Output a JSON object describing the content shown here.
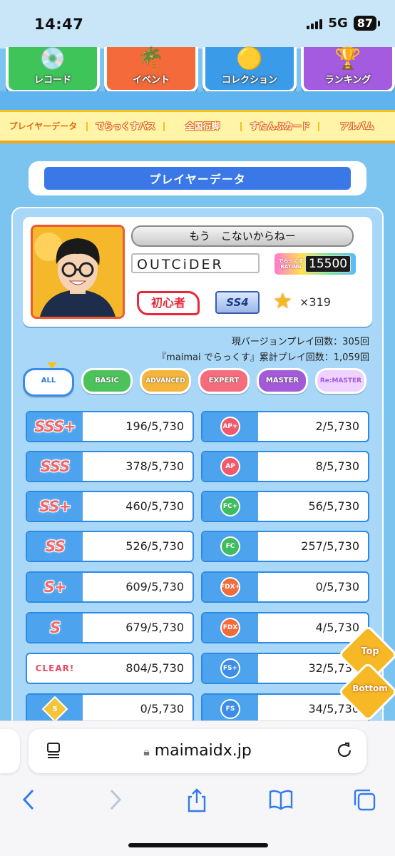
{
  "status": {
    "time": "14:47",
    "network": "5G",
    "battery": "87"
  },
  "top_tiles": [
    {
      "label": "レコード",
      "color": "#3fc45a"
    },
    {
      "label": "イベント",
      "color": "#f46a3a"
    },
    {
      "label": "コレクション",
      "color": "#3a9be8"
    },
    {
      "label": "ランキング",
      "color": "#a45be0"
    }
  ],
  "subnav": [
    "プレイヤーデータ",
    "でらっくすパス",
    "全国行脚",
    "すたんぷカード",
    "アルバム"
  ],
  "section_title": "プレイヤーデータ",
  "player": {
    "title": "もう　こないからねー",
    "name": "OUTCiDER",
    "rating_label": "でらっくす RATING",
    "rating": "15500",
    "class": "初心者",
    "course_rank": "SS4",
    "star_count": "×319"
  },
  "plays": {
    "current": "現バージョンプレイ回数：305回",
    "total": "『maimai でらっくす』累計プレイ回数：1,059回"
  },
  "difficulty_tabs": [
    {
      "label": "ALL",
      "color": "#ffffff"
    },
    {
      "label": "BASIC",
      "color": "#4cc25a"
    },
    {
      "label": "ADVANCED",
      "color": "#f5b43a"
    },
    {
      "label": "EXPERT",
      "color": "#f56d7d"
    },
    {
      "label": "MASTER",
      "color": "#a35ad8"
    },
    {
      "label": "Re:MASTER",
      "color": "#efd2ff"
    }
  ],
  "rank_stats": [
    {
      "badge": "SSS+",
      "value": "196/5,730"
    },
    {
      "badge": "SSS",
      "value": "378/5,730"
    },
    {
      "badge": "SS+",
      "value": "460/5,730"
    },
    {
      "badge": "SS",
      "value": "526/5,730"
    },
    {
      "badge": "S+",
      "value": "609/5,730"
    },
    {
      "badge": "S",
      "value": "679/5,730"
    },
    {
      "badge": "CLEAR!",
      "value": "804/5,730"
    },
    {
      "badge": "5",
      "value": "0/5,730"
    }
  ],
  "combo_stats": [
    {
      "badge": "AP+",
      "value": "2/5,730"
    },
    {
      "badge": "AP",
      "value": "8/5,730"
    },
    {
      "badge": "FC+",
      "value": "56/5,730"
    },
    {
      "badge": "FC",
      "value": "257/5,730"
    },
    {
      "badge": "FDX+",
      "value": "0/5,730"
    },
    {
      "badge": "FDX",
      "value": "4/5,730"
    },
    {
      "badge": "FS+",
      "value": "32/5,730"
    },
    {
      "badge": "FS",
      "value": "34/5,730"
    }
  ],
  "float_buttons": {
    "top": "Top",
    "bottom": "Bottom"
  },
  "browser": {
    "url": "maimaidx.jp"
  }
}
